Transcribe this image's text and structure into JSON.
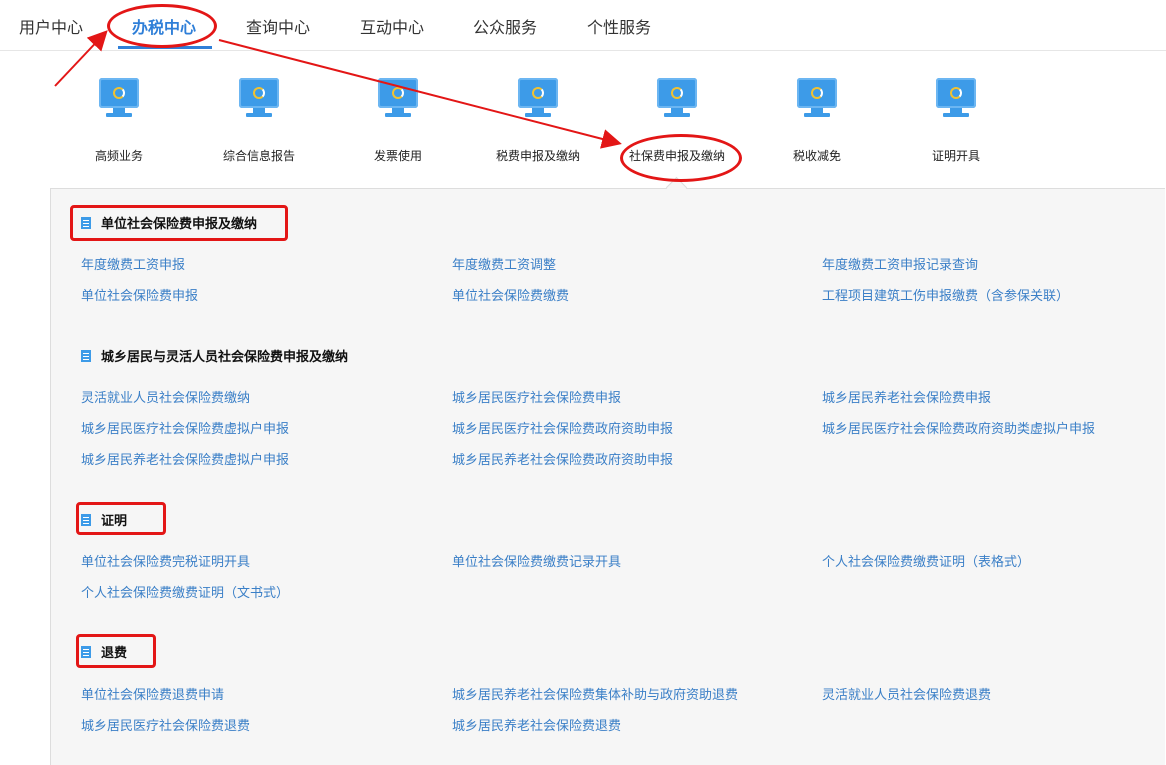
{
  "nav": {
    "items": [
      "用户中心",
      "办税中心",
      "查询中心",
      "互动中心",
      "公众服务",
      "个性服务"
    ],
    "active": "办税中心"
  },
  "tiles": [
    {
      "label": "高频业务",
      "icon": "monitor-icon"
    },
    {
      "label": "综合信息报告",
      "icon": "monitor-icon"
    },
    {
      "label": "发票使用",
      "icon": "monitor-icon"
    },
    {
      "label": "税费申报及缴纳",
      "icon": "monitor-icon"
    },
    {
      "label": "社保费申报及缴纳",
      "icon": "monitor-icon"
    },
    {
      "label": "税收减免",
      "icon": "monitor-icon"
    },
    {
      "label": "证明开具",
      "icon": "monitor-icon"
    }
  ],
  "sections": [
    {
      "title": "单位社会保险费申报及缴纳",
      "links": [
        "年度缴费工资申报",
        "年度缴费工资调整",
        "年度缴费工资申报记录查询",
        "单位社会保险费申报",
        "单位社会保险费缴费",
        "工程项目建筑工伤申报缴费（含参保关联）"
      ]
    },
    {
      "title": "城乡居民与灵活人员社会保险费申报及缴纳",
      "links": [
        "灵活就业人员社会保险费缴纳",
        "城乡居民医疗社会保险费申报",
        "城乡居民养老社会保险费申报",
        "城乡居民医疗社会保险费虚拟户申报",
        "城乡居民医疗社会保险费政府资助申报",
        "城乡居民医疗社会保险费政府资助类虚拟户申报",
        "城乡居民养老社会保险费虚拟户申报",
        "城乡居民养老社会保险费政府资助申报"
      ]
    },
    {
      "title": "证明",
      "links": [
        "单位社会保险费完税证明开具",
        "单位社会保险费缴费记录开具",
        "个人社会保险费缴费证明（表格式）",
        "个人社会保险费缴费证明（文书式）"
      ]
    },
    {
      "title": "退费",
      "links": [
        "单位社会保险费退费申请",
        "城乡居民养老社会保险费集体补助与政府资助退费",
        "灵活就业人员社会保险费退费",
        "城乡居民医疗社会保险费退费",
        "城乡居民养老社会保险费退费"
      ]
    }
  ],
  "colors": {
    "accent": "#2f7fd8",
    "link": "#3a7fc7",
    "annotation": "#e31616"
  }
}
